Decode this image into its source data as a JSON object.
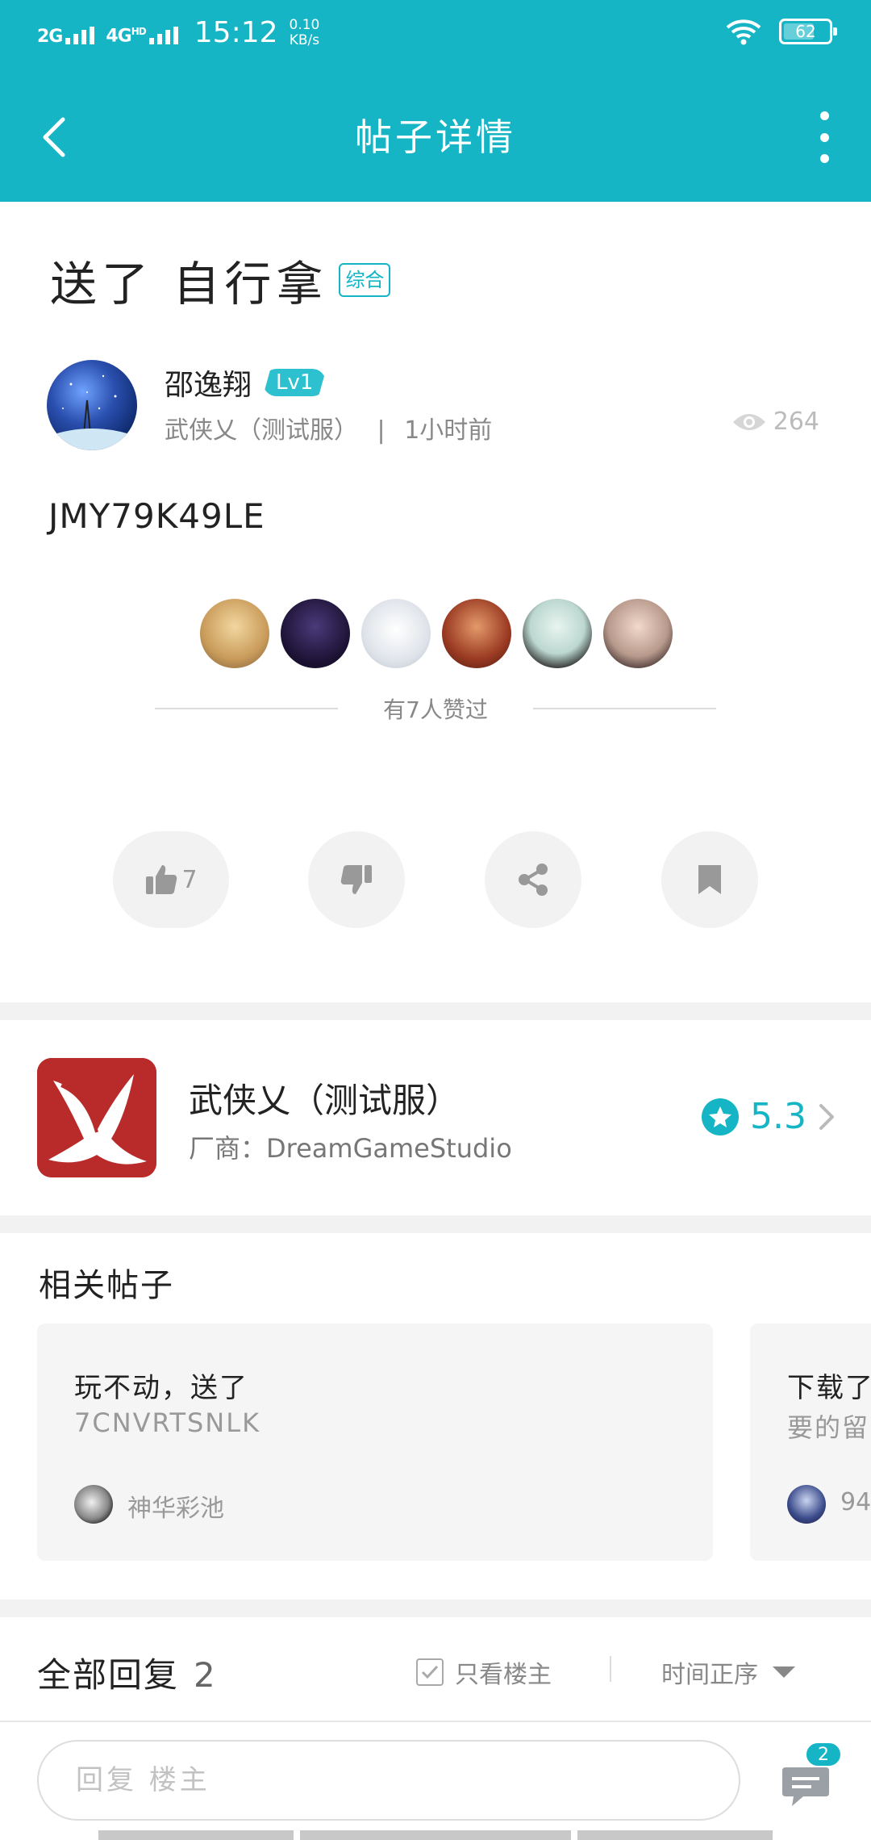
{
  "status_bar": {
    "network_1": "2G",
    "network_2": "4G",
    "network_2_sup": "HD",
    "time": "15:12",
    "speed_value": "0.10",
    "speed_unit": "KB/s",
    "battery": "62",
    "battery_level": 0.62
  },
  "app_bar": {
    "title": "帖子详情",
    "back_icon": "chevron-left-icon",
    "more_icon": "more-vertical-icon"
  },
  "post": {
    "title": "送了 自行拿",
    "category_tag": "综合",
    "author": {
      "name": "邵逸翔",
      "level": "Lv1",
      "game": "武侠乂（测试服）",
      "separator": "|",
      "time_ago": "1小时前"
    },
    "views": "264",
    "content": "JMY79K49LE",
    "liked_summary": "有7人赞过",
    "likers": [
      "avatar-1",
      "avatar-2",
      "avatar-3",
      "avatar-4",
      "avatar-5",
      "avatar-6"
    ],
    "actions": {
      "like_count": "7",
      "like_icon": "thumbs-up-icon",
      "dislike_icon": "thumbs-down-icon",
      "share_icon": "share-icon",
      "bookmark_icon": "bookmark-icon"
    }
  },
  "game_card": {
    "name": "武侠乂（测试服）",
    "vendor_label": "厂商：",
    "vendor": "DreamGameStudio",
    "rating": "5.3"
  },
  "related": {
    "heading": "相关帖子",
    "cards": [
      {
        "title": "玩不动，送了",
        "snippet": "7CNVRTSNLK",
        "user": "神华彩池"
      },
      {
        "title": "下载了",
        "snippet": "要的留",
        "user": "94"
      }
    ]
  },
  "replies": {
    "heading": "全部回复",
    "count": "2",
    "only_op_label": "只看楼主",
    "sort_label": "时间正序"
  },
  "bottom_bar": {
    "reply_placeholder": "回复 楼主",
    "comment_badge": "2"
  },
  "colors": {
    "accent": "#15b5c6",
    "level_badge": "#2dc1cf",
    "game_icon": "#c12d2d"
  }
}
